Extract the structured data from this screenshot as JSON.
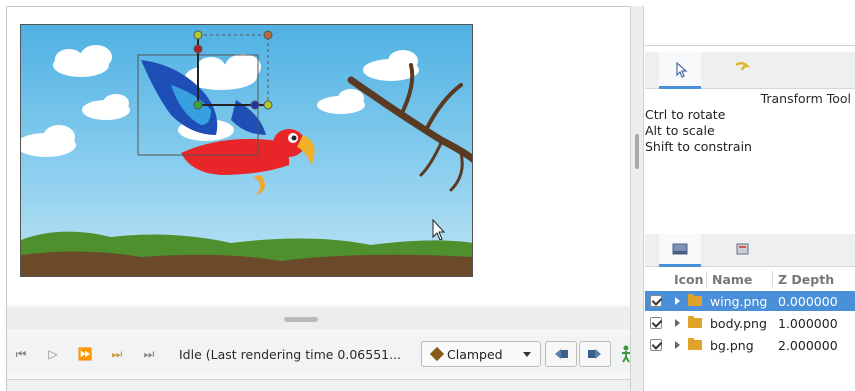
{
  "canvas": {
    "scene_description_icons": [
      "parrot-image",
      "tree-branch-image",
      "cloud-image"
    ]
  },
  "playbar": {
    "buttons": [
      "seek-begin-icon",
      "play-icon",
      "seek-forward-icon",
      "seek-keyframe-icon",
      "seek-end-icon"
    ],
    "status": "Idle (Last rendering time 0.06551...",
    "interpolation": "Clamped"
  },
  "tool_panel": {
    "title": "Transform Tool",
    "hints": [
      "Ctrl to rotate",
      "Alt to scale",
      "Shift to constrain"
    ]
  },
  "layers_panel": {
    "columns": [
      "Icon",
      "Name",
      "Z Depth"
    ],
    "rows": [
      {
        "name": "wing.png",
        "z": "0.000000",
        "checked": true,
        "selected": true
      },
      {
        "name": "body.png",
        "z": "1.000000",
        "checked": true,
        "selected": false
      },
      {
        "name": "bg.png",
        "z": "2.000000",
        "checked": true,
        "selected": false
      }
    ]
  },
  "colors": {
    "accent": "#4a90d9",
    "sky": "#5cb8e6",
    "folder": "#e0a229"
  }
}
